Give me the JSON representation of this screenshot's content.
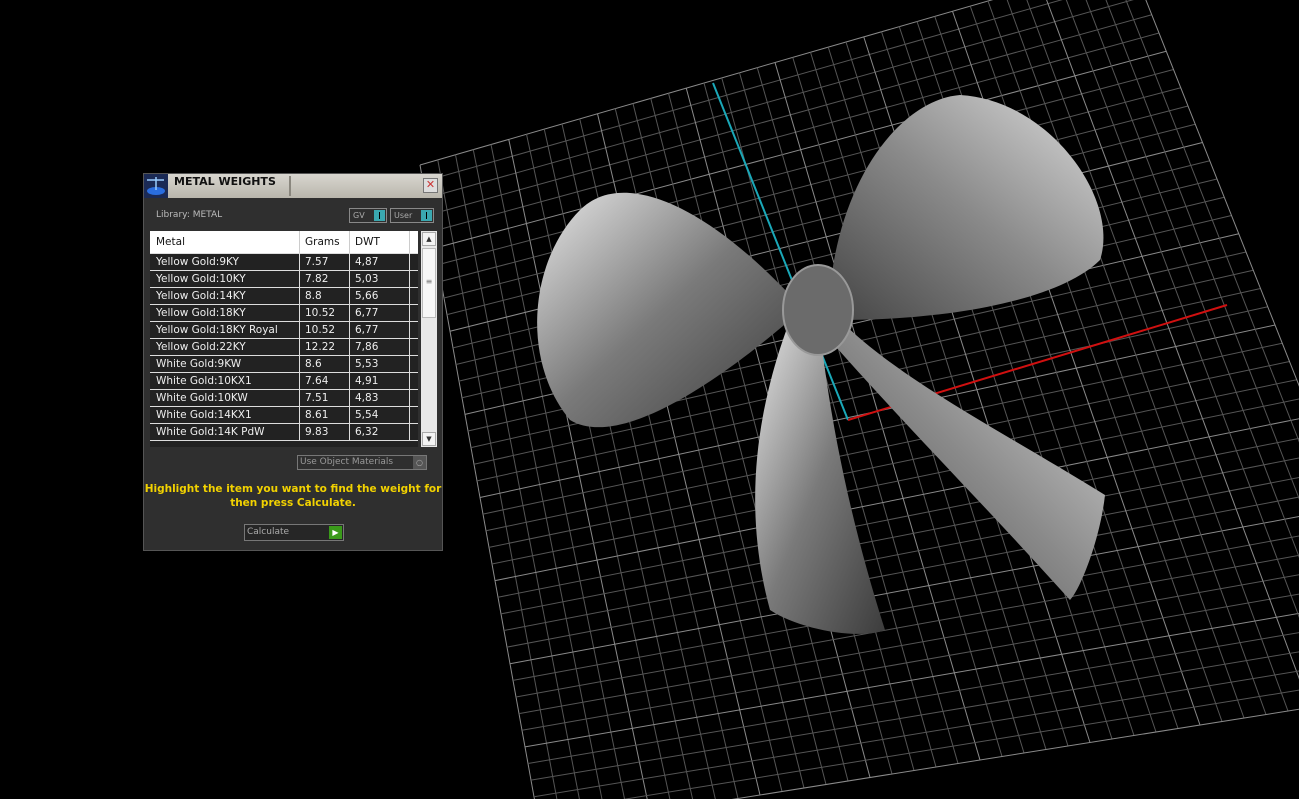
{
  "panel": {
    "title": "METAL WEIGHTS",
    "close_icon": "close-icon",
    "library_label": "Library: METAL",
    "toggles": [
      {
        "label": "GV"
      },
      {
        "label": "User"
      }
    ],
    "columns": [
      "Metal",
      "Grams",
      "DWT"
    ],
    "rows": [
      [
        "Yellow Gold:9KY",
        "7.57",
        "4,87"
      ],
      [
        "Yellow Gold:10KY",
        "7.82",
        "5,03"
      ],
      [
        "Yellow Gold:14KY",
        "8.8",
        "5,66"
      ],
      [
        "Yellow Gold:18KY",
        "10.52",
        "6,77"
      ],
      [
        "Yellow Gold:18KY Royal",
        "10.52",
        "6,77"
      ],
      [
        "Yellow Gold:22KY",
        "12.22",
        "7,86"
      ],
      [
        "White Gold:9KW",
        "8.6",
        "5,53"
      ],
      [
        "White Gold:10KX1",
        "7.64",
        "4,91"
      ],
      [
        "White Gold:10KW",
        "7.51",
        "4,83"
      ],
      [
        "White Gold:14KX1",
        "8.61",
        "5,54"
      ],
      [
        "White Gold:14K PdW",
        "9.83",
        "6,32"
      ]
    ],
    "use_object_materials": "Use Object Materials",
    "hint": "Highlight the item you want to find the weight for then press Calculate.",
    "calculate_label": "Calculate"
  },
  "colors": {
    "hint": "#f2d200",
    "x_axis": "#d01010",
    "y_axis": "#1aa8b8",
    "toggle": "#3aa8b0"
  }
}
